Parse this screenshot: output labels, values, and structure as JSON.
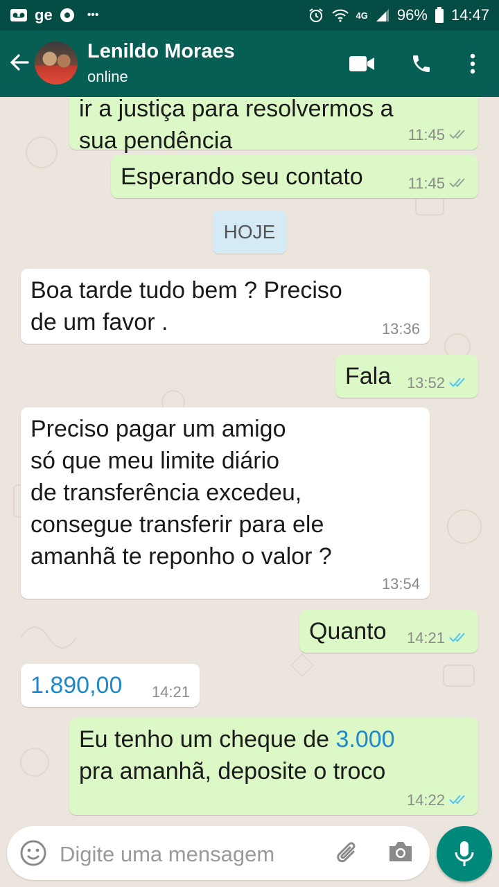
{
  "status_bar": {
    "carrier_label": "ge",
    "more_label": "•••",
    "network_label": "4G",
    "battery": "96%",
    "time": "14:47"
  },
  "header": {
    "contact_name": "Lenildo Moraes",
    "contact_status": "online"
  },
  "messages": [
    {
      "direction": "out",
      "text_lines": [
        "ir a justiça para resolvermos a",
        "sua pendência"
      ],
      "time": "11:45",
      "ticks": "read-grey"
    },
    {
      "direction": "out",
      "text": "Esperando seu contato",
      "time": "11:45",
      "ticks": "read-grey"
    },
    {
      "type": "date",
      "text": "HOJE"
    },
    {
      "direction": "in",
      "text_lines": [
        "Boa tarde tudo bem ? Preciso",
        "de um favor ."
      ],
      "time": "13:36"
    },
    {
      "direction": "out",
      "text": "Fala",
      "time": "13:52",
      "ticks": "read-blue"
    },
    {
      "direction": "in",
      "text_lines": [
        "Preciso pagar um amigo",
        "só que meu limite diário",
        "de transferência excedeu,",
        "consegue transferir para ele",
        "amanhã te reponho o valor ?"
      ],
      "time": "13:54"
    },
    {
      "direction": "out",
      "text": "Quanto",
      "time": "14:21",
      "ticks": "read-blue"
    },
    {
      "direction": "in",
      "text": "1.890,00",
      "time": "14:21"
    },
    {
      "direction": "out",
      "text_parts": [
        "Eu tenho um cheque  de ",
        "3.000"
      ],
      "text_line2": "pra amanhã, deposite o troco",
      "time": "14:22",
      "ticks": "read-blue"
    }
  ],
  "composer": {
    "placeholder": "Digite uma mensagem"
  },
  "colors": {
    "header": "#075e54",
    "status_bar": "#054d44",
    "outgoing_bubble": "#dcf8c6",
    "incoming_bubble": "#ffffff",
    "read_ticks": "#4fc3f7",
    "mic_button": "#00897b",
    "link": "#1e88c8"
  }
}
